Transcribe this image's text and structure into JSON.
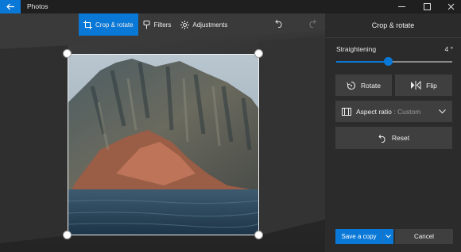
{
  "app": {
    "title": "Photos"
  },
  "toolbar": {
    "crop_label": "Crop & rotate",
    "filters_label": "Filters",
    "adjustments_label": "Adjustments"
  },
  "panel": {
    "title": "Crop & rotate",
    "straightening_label": "Straightening",
    "straightening_value": "4 °",
    "straightening_fraction": 0.45,
    "rotate_label": "Rotate",
    "flip_label": "Flip",
    "aspect_label": "Aspect ratio",
    "aspect_value": ": Custom",
    "reset_label": "Reset"
  },
  "footer": {
    "save_label": "Save a copy",
    "cancel_label": "Cancel"
  },
  "colors": {
    "accent": "#0a78d7",
    "panel_bg": "#2b2b2b",
    "button_bg": "#3f3f3f"
  },
  "icons": [
    "back-arrow-icon",
    "minimize-icon",
    "maximize-icon",
    "close-icon",
    "crop-icon",
    "filters-icon",
    "adjustments-icon",
    "undo-icon",
    "redo-icon",
    "rotate-icon",
    "flip-icon",
    "aspect-ratio-icon",
    "chevron-down-icon",
    "reset-icon"
  ]
}
